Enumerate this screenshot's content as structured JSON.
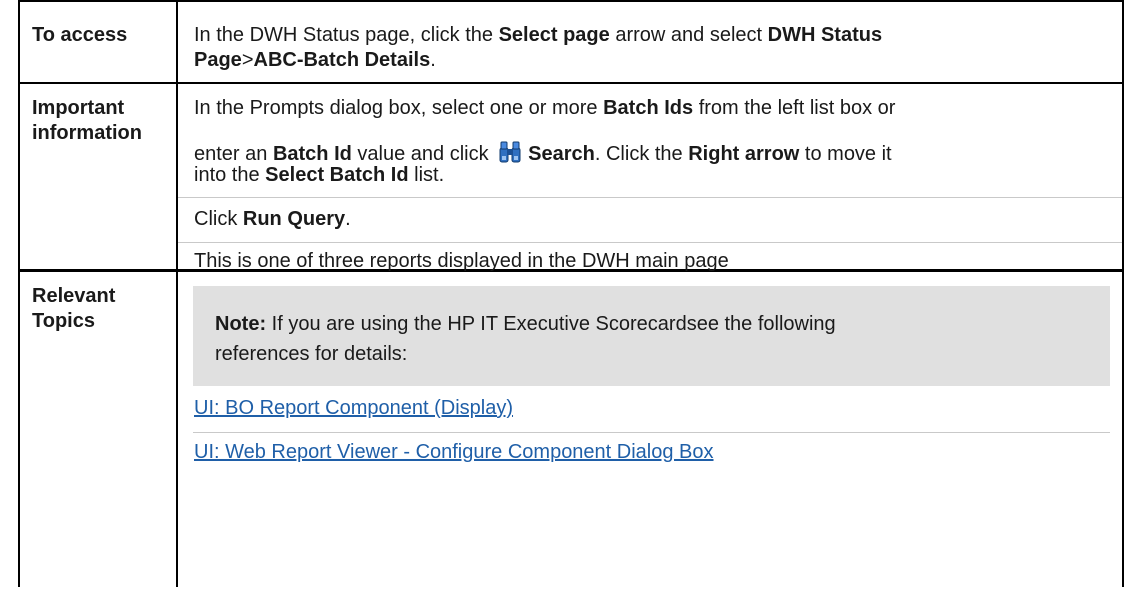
{
  "rows": {
    "access": {
      "label": "To access",
      "text_1": "In the DWH Status page, click the ",
      "select_page": "Select page",
      "text_2": " arrow and select ",
      "dwh_status": "DWH Status",
      "page": "Page",
      "gt": ">",
      "abc_batch": "ABC-Batch Details",
      "period": "."
    },
    "important": {
      "label_line1": "Important",
      "label_line2": "information",
      "l1_a": "In the Prompts dialog box, select one or more ",
      "l1_batch_ids": "Batch Ids",
      "l1_b": " from the left list box or",
      "l2_a": "enter an ",
      "l2_batch_id": "Batch Id",
      "l2_b": " value and click ",
      "l2_search": "Search",
      "l2_c": ". Click the ",
      "l2_right_arrow": "Right arrow",
      "l2_d": " to move it",
      "l3_a": "into the ",
      "l3_select_batch": "Select Batch Id",
      "l3_b": " list.",
      "l4_a": "Click ",
      "l4_run_query": "Run Query",
      "l4_b": ".",
      "l5": "This is one of three reports displayed in the DWH main page",
      "search_icon": "binoculars-icon"
    },
    "relevant": {
      "label_line1": "Relevant",
      "label_line2": "Topics",
      "note_label": "Note:",
      "note_line1": " If you are using the HP IT Executive Scorecardsee the following",
      "note_line2": "references for details:",
      "links": [
        "UI: BO Report Component (Display)",
        "UI: Web Report Viewer - Configure Component Dialog Box"
      ]
    }
  },
  "colors": {
    "link": "#1f5fa8",
    "note_bg": "#e0e0e0",
    "border": "#000000"
  }
}
